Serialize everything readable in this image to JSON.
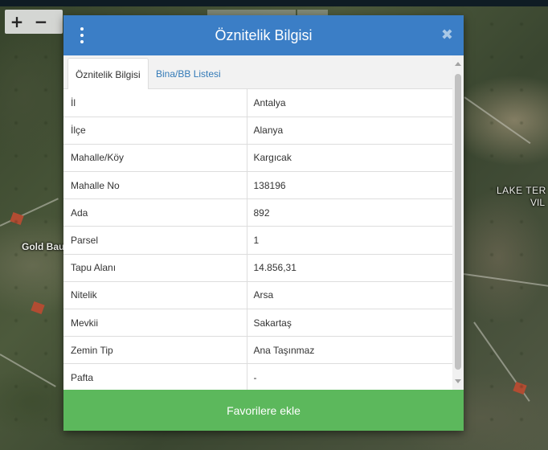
{
  "map": {
    "zoom_in": "+",
    "zoom_out": "−",
    "labels": {
      "lake_line1": "LAKE TER",
      "lake_line2": "VIL",
      "gold": "Gold Bau"
    }
  },
  "modal": {
    "title": "Öznitelik Bilgisi",
    "menu_icon": "kebab-menu-icon",
    "close_label": "✖",
    "header_color": "#3b7ec6",
    "footer_color": "#5cb85c",
    "tabs": [
      {
        "label": "Öznitelik Bilgisi",
        "active": true
      },
      {
        "label": "Bina/BB Listesi",
        "active": false
      }
    ],
    "rows": [
      {
        "key": "İl",
        "value": "Antalya"
      },
      {
        "key": "İlçe",
        "value": "Alanya"
      },
      {
        "key": "Mahalle/Köy",
        "value": "Kargıcak"
      },
      {
        "key": "Mahalle No",
        "value": "138196"
      },
      {
        "key": "Ada",
        "value": "892"
      },
      {
        "key": "Parsel",
        "value": "1"
      },
      {
        "key": "Tapu Alanı",
        "value": "14.856,31"
      },
      {
        "key": "Nitelik",
        "value": "Arsa"
      },
      {
        "key": "Mevkii",
        "value": "Sakartaş"
      },
      {
        "key": "Zemin Tip",
        "value": "Ana Taşınmaz"
      },
      {
        "key": "Pafta",
        "value": "-"
      }
    ],
    "footer_button": "Favorilere ekle"
  }
}
